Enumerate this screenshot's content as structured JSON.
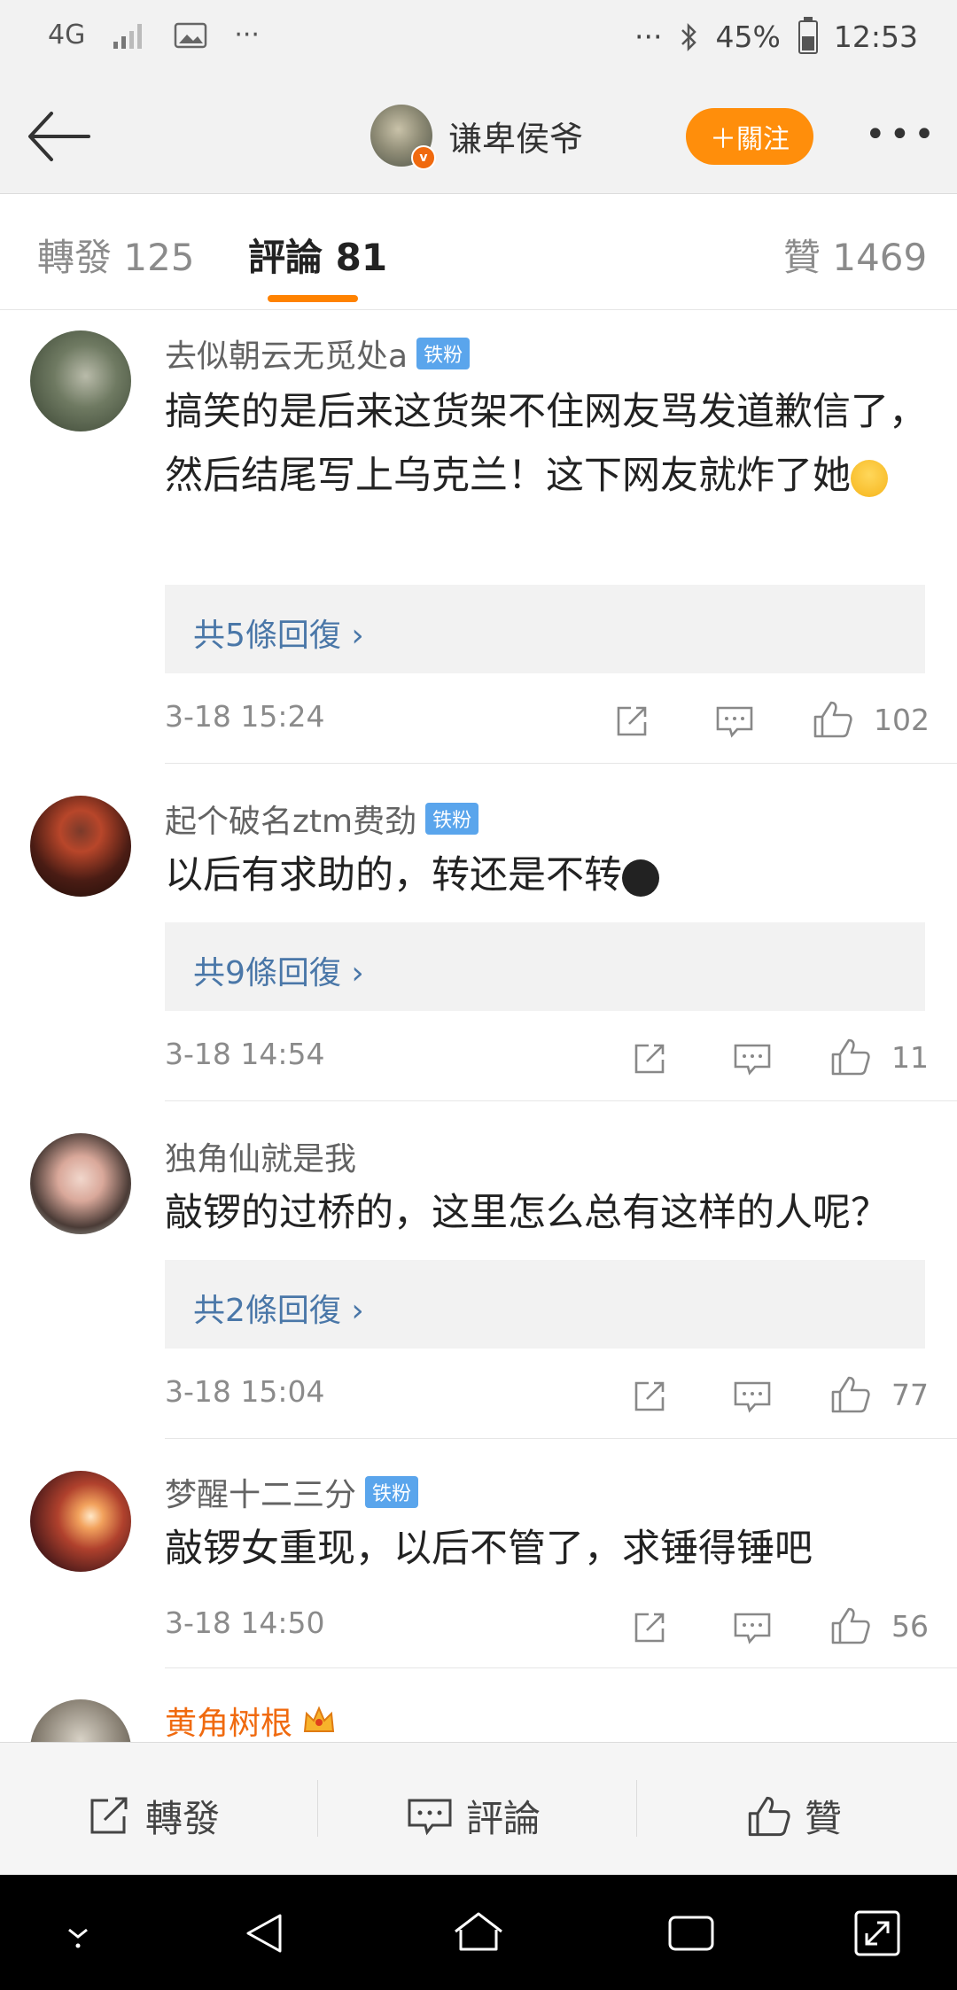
{
  "status_bar": {
    "network": "4G",
    "more": "···",
    "right_more": "···",
    "battery_percent": "45%",
    "time": "12:53",
    "battery_level": 0.45
  },
  "nav": {
    "username": "谦卑侯爷",
    "follow_label": "＋關注",
    "more_label": "•••"
  },
  "tabs": {
    "repost": "轉發 125",
    "comments": "評論 81",
    "likes": "贊 1469"
  },
  "comments": [
    {
      "name": "去似朝云无觅处a",
      "badge": "铁粉",
      "text": "搞笑的是后来这货架不住网友骂发道歉信了，然后结尾写上乌克兰！这下网友就炸了她",
      "emoji": "grin-emoji",
      "replies": "共5條回復 ›",
      "time": "3-18 15:24",
      "likes": "102"
    },
    {
      "name": "起个破名ztm费劲",
      "badge": "铁粉",
      "text": "以后有求助的，转还是不转",
      "emoji": "tear-emoji",
      "replies": "共9條回復 ›",
      "time": "3-18 14:54",
      "likes": "11"
    },
    {
      "name": "独角仙就是我",
      "badge": "",
      "text": "敲锣的过桥的，这里怎么总有这样的人呢？",
      "replies": "共2條回復 ›",
      "time": "3-18 15:04",
      "likes": "77"
    },
    {
      "name": "梦醒十二三分",
      "badge": "铁粉",
      "text": "敲锣女重现，以后不管了，求锤得锤吧",
      "time": "3-18 14:50",
      "likes": "56"
    },
    {
      "name": "黄角树根",
      "badge_icon": "crown-icon"
    }
  ],
  "bottom_bar": {
    "repost": "轉發",
    "comment": "評論",
    "like": "贊"
  },
  "colors": {
    "accent": "#ff8200",
    "link": "#4a77a8",
    "badge": "#5aa5ec",
    "vip_name": "#f06a0f"
  }
}
